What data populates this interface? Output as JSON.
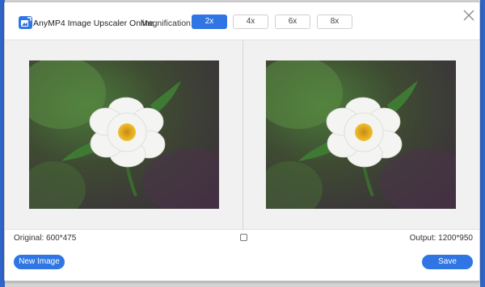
{
  "app": {
    "title": "AnyMP4 Image Upscaler Online",
    "logo_icon": "image-upscale-logo-icon"
  },
  "magnification": {
    "label": "Magnification:",
    "options": [
      "2x",
      "4x",
      "6x",
      "8x"
    ],
    "selected": "2x"
  },
  "preview": {
    "original_label": "Original: 600*475",
    "output_label": "Output: 1200*950",
    "image_subject": "white-flower-photo"
  },
  "actions": {
    "new_image": "New Image",
    "save": "Save"
  },
  "colors": {
    "accent": "#2f76e4",
    "panel_bg": "#f1f1f1"
  }
}
